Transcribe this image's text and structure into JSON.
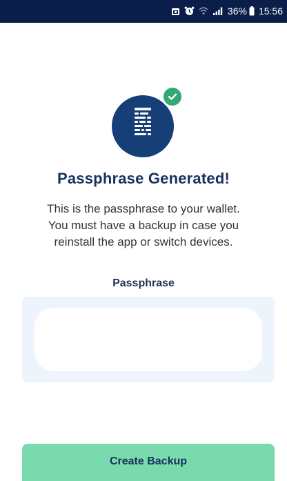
{
  "status_bar": {
    "icons": [
      "calendar-icon",
      "alarm-icon",
      "wifi-icon",
      "signal-icon"
    ],
    "battery": "36%",
    "time": "15:56"
  },
  "hero": {
    "icon": "passphrase-document-icon",
    "badge_icon": "check-icon",
    "circle_color": "#163e77",
    "badge_color": "#33a873"
  },
  "title": "Passphrase Generated!",
  "description": {
    "line1": "This is the passphrase to your wallet.",
    "line2": "You must have a backup in case you",
    "line3": "reinstall the app or switch devices."
  },
  "passphrase": {
    "label": "Passphrase",
    "value": ""
  },
  "actions": {
    "create_backup": "Create Backup"
  },
  "colors": {
    "title": "#15335f",
    "button": "#7ad9ad",
    "panel": "#eef4fb"
  }
}
